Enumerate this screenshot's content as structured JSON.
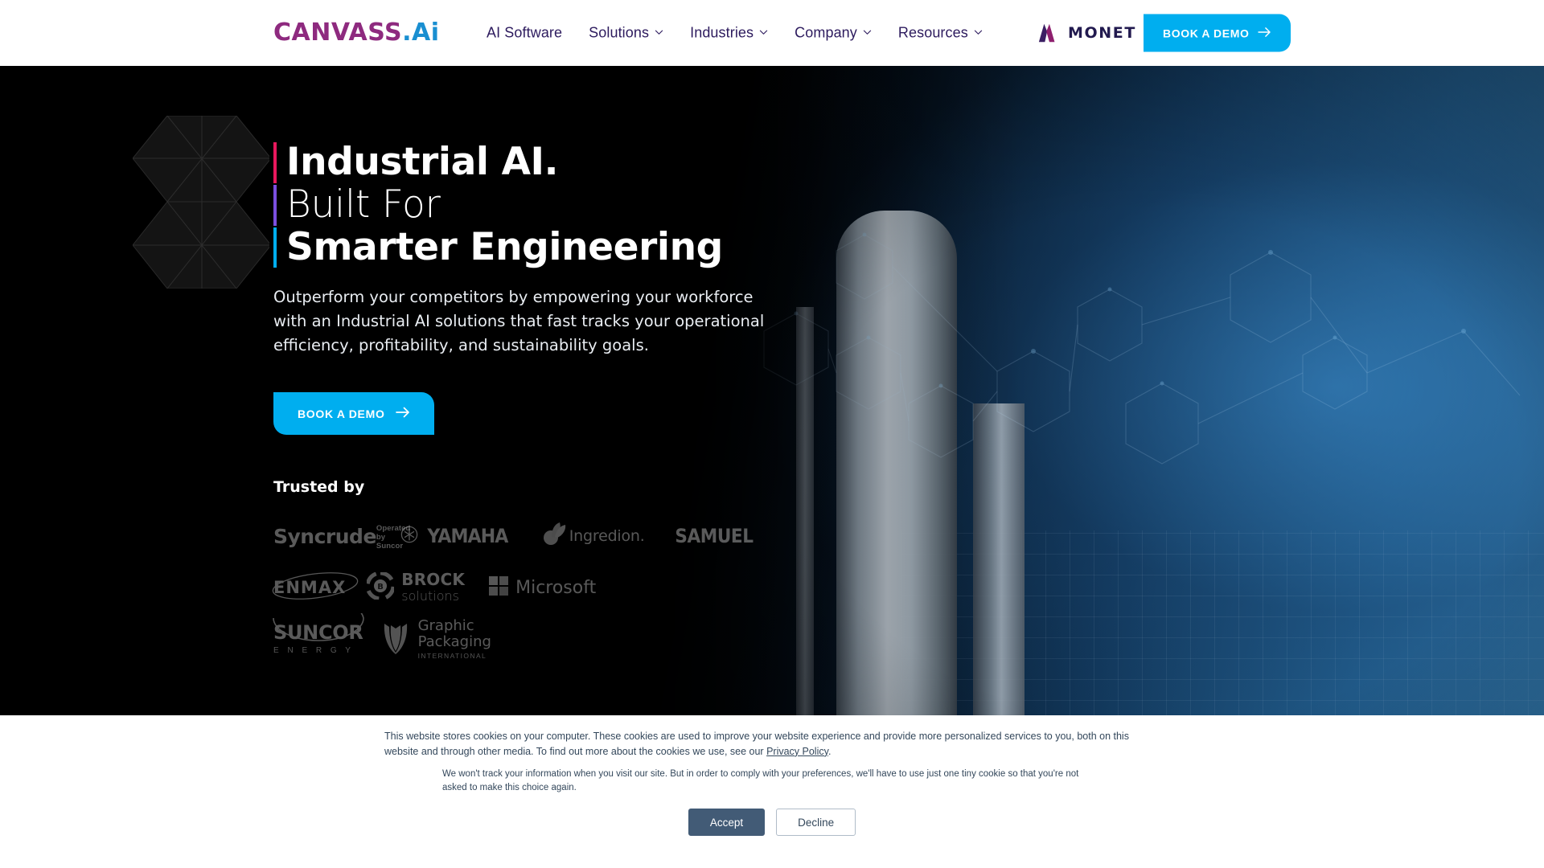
{
  "header": {
    "logo": {
      "primary": "CANVASS",
      "accent": ".Ai",
      "primary_color": "#8e2a7f",
      "accent_color": "#1a8fd1"
    },
    "nav": [
      {
        "label": "AI Software",
        "has_dropdown": false
      },
      {
        "label": "Solutions",
        "has_dropdown": true
      },
      {
        "label": "Industries",
        "has_dropdown": true
      },
      {
        "label": "Company",
        "has_dropdown": true
      },
      {
        "label": "Resources",
        "has_dropdown": true
      }
    ],
    "partner": {
      "name": "MONET",
      "mark_color": "#7b1f6e"
    },
    "cta": {
      "label": "BOOK A DEMO",
      "icon": "arrow-right-icon",
      "color": "#00AEEF"
    }
  },
  "hero": {
    "headline": [
      {
        "text": "Industrial AI.",
        "weight": "bold",
        "accent_color": "#e8185d"
      },
      {
        "text": "Built For",
        "weight": "light",
        "accent_color": "#7b4fe0"
      },
      {
        "text": "Smarter Engineering",
        "weight": "bold",
        "accent_color": "#00AEEF"
      }
    ],
    "paragraph": "Outperform your competitors by empowering your workforce with an Industrial AI solutions that fast tracks your operational efficiency, profitability, and sustainability goals.",
    "cta": {
      "label": "BOOK A DEMO",
      "icon": "arrow-right-icon",
      "color": "#00AEEF"
    },
    "trusted_label": "Trusted by",
    "logos": [
      {
        "name": "Syncrude",
        "line1": "Syncrude",
        "line2": "Operated by Suncor"
      },
      {
        "name": "Yamaha",
        "line1": "YAMAHA",
        "line2": ""
      },
      {
        "name": "Ingredion",
        "line1": "Ingredion.",
        "line2": ""
      },
      {
        "name": "Samuel",
        "line1": "SAMUEL",
        "line2": ""
      },
      {
        "name": "Enmax",
        "line1": "ENMAX",
        "line2": ""
      },
      {
        "name": "Brock Solutions",
        "line1": "BROCK",
        "line2": "solutions"
      },
      {
        "name": "Microsoft",
        "line1": "Microsoft",
        "line2": ""
      },
      {
        "name": "Suncor Energy",
        "line1": "SUNCOR",
        "line2": "E N E R G Y"
      },
      {
        "name": "Graphic Packaging International",
        "line1": "Graphic",
        "line2": "Packaging",
        "line3": "INTERNATIONAL"
      }
    ]
  },
  "cookie_banner": {
    "paragraph_1_a": "This website stores cookies on your computer. These cookies are used to improve your website experience and provide more personalized services to you, both on this website and through other media. To find out more about the cookies we use, see our ",
    "paragraph_1_link": "Privacy Policy",
    "paragraph_1_b": ".",
    "paragraph_2": "We won't track your information when you visit our site. But in order to comply with your preferences, we'll have to use just one tiny cookie so that you're not asked to make this choice again.",
    "accept_label": "Accept",
    "decline_label": "Decline"
  }
}
